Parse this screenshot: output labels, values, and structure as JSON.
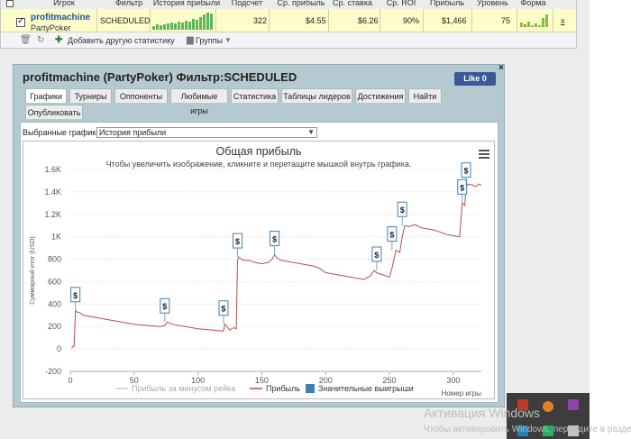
{
  "table": {
    "headers": [
      "Игрок",
      "Фильтр",
      "История прибыли",
      "Подсчет",
      "Ср. прибыль",
      "Ср. ставка",
      "Ср. ROI",
      "Прибыль",
      "Уровень",
      "Форма"
    ],
    "row": {
      "player": "profitmachine",
      "network": "PartyPoker",
      "filter": "SCHEDULED",
      "count": "322",
      "avg_profit": "$4.55",
      "avg_stake": "$6.26",
      "avg_roi": "90%",
      "profit": "$1,466",
      "level": "75",
      "remove": "x"
    },
    "toolbar": {
      "add_stats": "Добавить другую статистику",
      "groups": "Группы"
    }
  },
  "dialog": {
    "title": "profitmachine (PartyPoker) Фильтр:SCHEDULED",
    "like": "Like 0",
    "close": "×",
    "tabs": [
      "Графики",
      "Турниры",
      "Оппоненты",
      "Любимые игры",
      "Статистика",
      "Таблицы лидеров",
      "Достижения",
      "Найти",
      "Опубликовать"
    ],
    "selector_label": "Выбранные графики:",
    "selector_value": "История прибыли"
  },
  "chart_data": {
    "type": "line",
    "title": "Общая прибыль",
    "subtitle": "Чтобы увеличить изображение, кликните и перетащите мышкой внутрь графика.",
    "ylabel": "Суммарный итог (USD)",
    "xlabel": "Номер игры",
    "ylim": [
      -200,
      1600
    ],
    "xlim": [
      0,
      322
    ],
    "y_ticks": [
      "-200",
      "0",
      "200",
      "400",
      "600",
      "800",
      "1K",
      "1.2K",
      "1.4K",
      "1.6K"
    ],
    "x_ticks": [
      "0",
      "50",
      "100",
      "150",
      "200",
      "250",
      "300"
    ],
    "grid": true,
    "legend_position": "bottom",
    "legend": [
      "Прибыль за минусом рейка",
      "Прибыль",
      "Значительные выигрыши"
    ],
    "series": [
      {
        "name": "Прибыль",
        "color": "#b05050",
        "x": [
          1,
          2,
          3,
          4,
          5,
          8,
          10,
          15,
          20,
          25,
          30,
          40,
          50,
          60,
          70,
          74,
          76,
          80,
          90,
          100,
          110,
          115,
          120,
          121,
          125,
          128,
          130,
          131,
          132,
          135,
          140,
          145,
          150,
          155,
          158,
          160,
          162,
          165,
          170,
          180,
          190,
          195,
          200,
          210,
          220,
          230,
          235,
          238,
          240,
          245,
          250,
          252,
          255,
          258,
          260,
          262,
          265,
          270,
          275,
          280,
          285,
          290,
          295,
          300,
          305,
          307,
          309,
          310,
          312,
          315,
          318,
          320,
          322
        ],
        "y": [
          10,
          20,
          25,
          340,
          330,
          320,
          300,
          290,
          280,
          270,
          260,
          240,
          220,
          210,
          200,
          210,
          240,
          220,
          200,
          180,
          170,
          165,
          160,
          220,
          170,
          190,
          180,
          790,
          820,
          790,
          790,
          770,
          760,
          770,
          800,
          840,
          810,
          790,
          780,
          760,
          740,
          720,
          680,
          660,
          640,
          620,
          650,
          700,
          680,
          660,
          640,
          720,
          880,
          860,
          1000,
          1100,
          1090,
          1110,
          1080,
          1070,
          1060,
          1040,
          1020,
          1010,
          1000,
          1300,
          1280,
          1450,
          1470,
          1460,
          1450,
          1470,
          1460
        ]
      }
    ],
    "big_wins": {
      "name": "Значительные выигрыши",
      "x": [
        4,
        74,
        120,
        131,
        160,
        240,
        252,
        260,
        307,
        310
      ],
      "y": [
        340,
        240,
        220,
        820,
        840,
        700,
        880,
        1100,
        1300,
        1450
      ]
    },
    "big_win_label": "$"
  },
  "watermark": {
    "line1": "Активация Windows",
    "line2": "Чтобы активировать Windows, перейдите в раздел"
  }
}
